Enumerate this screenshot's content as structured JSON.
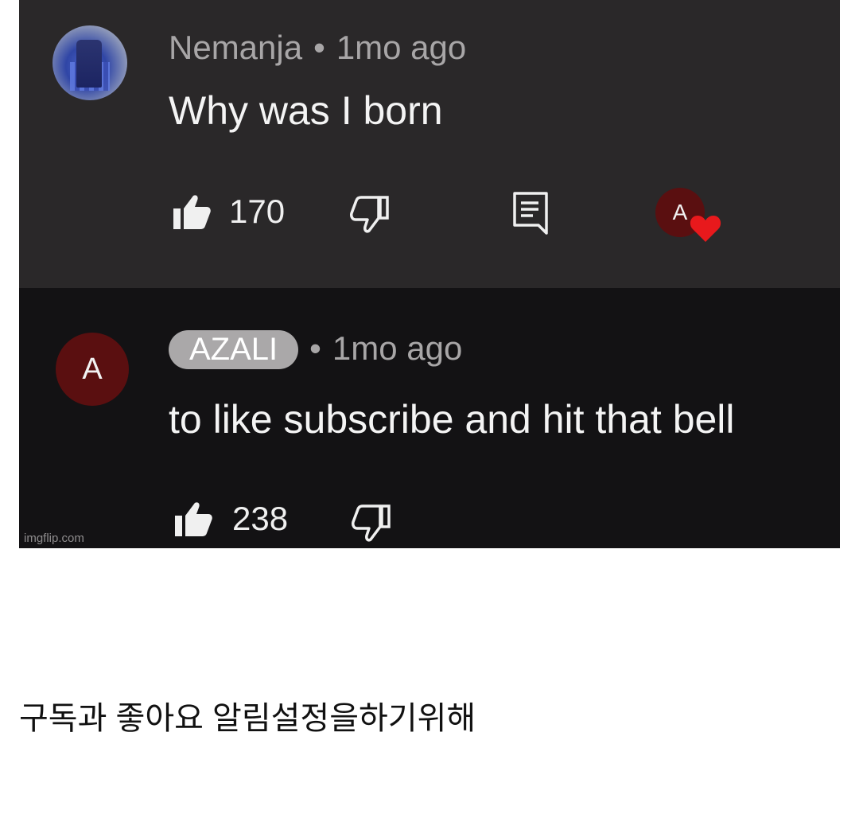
{
  "comments": [
    {
      "author": "Nemanja",
      "separator": "•",
      "time": "1mo ago",
      "text": "Why was I born",
      "likes": "170",
      "creator_avatar_letter": "A"
    },
    {
      "avatar_letter": "A",
      "author": "AZALI",
      "separator": "•",
      "time": "1mo ago",
      "text": "to like subscribe and hit that bell",
      "likes": "238"
    }
  ],
  "watermark": "imgflip.com",
  "caption": "구독과 좋아요 알림설정을하기위해",
  "colors": {
    "top_comment_bg": "#2a2829",
    "bottom_comment_bg": "#131214",
    "creator_avatar": "#5a0f10",
    "heart": "#e8191c",
    "author_chip": "#aaa8a9"
  },
  "icons": {
    "like": "thumbs-up-icon",
    "dislike": "thumbs-down-icon",
    "reply": "comment-icon",
    "creator_heart": "heart-icon"
  }
}
